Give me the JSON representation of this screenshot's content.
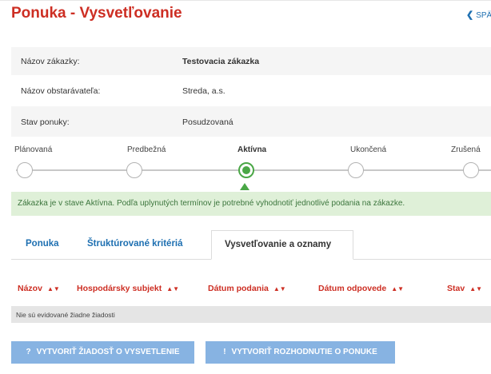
{
  "header": {
    "title": "Ponuka - Vysvetľovanie",
    "back_label": "SPÄ",
    "back_icon": "chevron-left-icon"
  },
  "info": {
    "rows": [
      {
        "label": "Názov zákazky:",
        "value": "Testovacia zákazka"
      },
      {
        "label": "Názov obstarávateľa:",
        "value": "Streda, a.s."
      },
      {
        "label": "Stav ponuky:",
        "value": "Posudzovaná"
      }
    ]
  },
  "steps": {
    "items": [
      "Plánovaná",
      "Predbežná",
      "Aktívna",
      "Ukončená",
      "Zrušená"
    ],
    "active_index": 2,
    "active_color": "#4aa746"
  },
  "notice": {
    "text": "Zákazka je v stave Aktívna. Podľa uplynutých termínov je potrebné vyhodnotiť jednotlivé podania na zákazke."
  },
  "tabs": {
    "items": [
      "Ponuka",
      "Štruktúrované kritériá",
      "Vysvetľovanie a oznamy"
    ],
    "active_index": 2
  },
  "table": {
    "columns": [
      "Názov",
      "Hospodársky subjekt",
      "Dátum podania",
      "Dátum odpovede",
      "Stav"
    ],
    "sort_icon": "sort-icon",
    "empty_text": "Nie sú evidované žiadne žiadosti"
  },
  "buttons": {
    "create_request": {
      "icon": "?",
      "label": "VYTVORIŤ ŽIADOSŤ O VYSVETLENIE"
    },
    "create_decision": {
      "icon": "!",
      "label": "VYTVORIŤ ROZHODNUTIE O PONUKE"
    }
  },
  "colors": {
    "title": "#cd2e23",
    "link": "#1d6fb1",
    "notice_bg": "#dff0d8",
    "notice_text": "#3c763d",
    "button_bg": "#87b3e2"
  }
}
